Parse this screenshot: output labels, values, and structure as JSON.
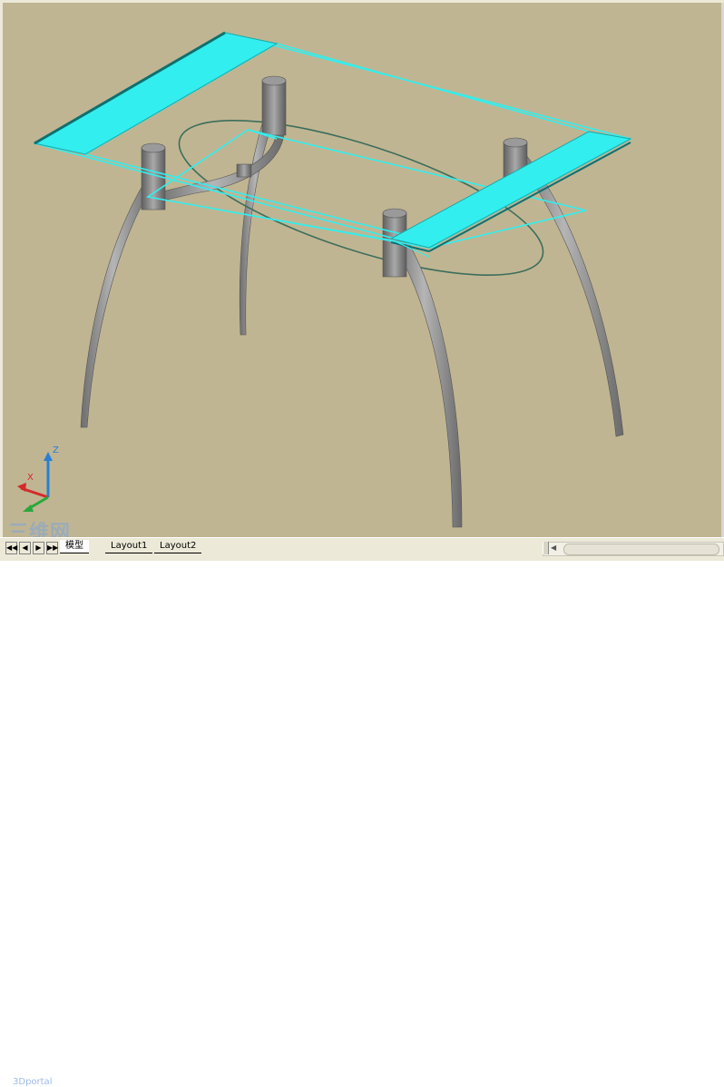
{
  "viewport": {
    "background_color": "#c0b592",
    "glass_color": "#33eeee",
    "leg_color": "#8c8c8c"
  },
  "ucs_icon": {
    "z_label": "Z",
    "x_label": "X"
  },
  "tabs": {
    "model_label": "模型",
    "layout1_label": "Layout1",
    "layout2_label": "Layout2"
  },
  "navigation": {
    "first_icon": "first-tab-icon",
    "prev_icon": "prev-tab-icon",
    "next_icon": "next-tab-icon",
    "last_icon": "last-tab-icon"
  },
  "watermark": {
    "main": "三维网",
    "sub": "3Dportal"
  }
}
